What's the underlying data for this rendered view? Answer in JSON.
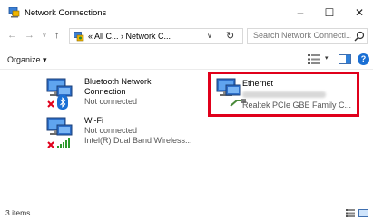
{
  "window": {
    "title": "Network Connections",
    "minimize_glyph": "–",
    "maximize_glyph": "☐",
    "close_glyph": "✕"
  },
  "nav": {
    "back_glyph": "←",
    "forward_glyph": "→",
    "recent_glyph": "∨",
    "up_glyph": "↑",
    "breadcrumb": "« All C...  ›  Network C...",
    "breadcrumb_dropdown_glyph": "∨",
    "refresh_glyph": "↻",
    "search_placeholder": "Search Network Connecti..."
  },
  "toolbar": {
    "organize_label": "Organize ▾",
    "view_dropdown_glyph": "▾",
    "help_glyph": "?"
  },
  "items": [
    {
      "name_line1": "Bluetooth Network",
      "name_line2": "Connection",
      "status": "Not connected"
    },
    {
      "name": "Wi-Fi",
      "status": "Not connected",
      "adapter": "Intel(R) Dual Band Wireless..."
    },
    {
      "name": "Ethernet",
      "adapter": "Realtek PCIe GBE Family C..."
    }
  ],
  "status_bar": {
    "item_count": "3 items"
  },
  "colors": {
    "highlight": "#e0001b",
    "accent": "#1a6fd4"
  },
  "icons": [
    "network-connections-icon",
    "search-icon",
    "bluetooth-icon",
    "wifi-signal-icon",
    "error-x-icon",
    "computer-monitor-icon",
    "ethernet-cable-icon",
    "help-icon"
  ]
}
